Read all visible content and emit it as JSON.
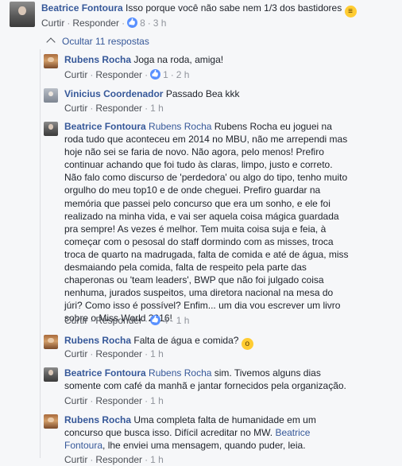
{
  "comments": [
    {
      "author": "Beatrice Fontoura",
      "tag": "",
      "text": "Isso porque você não sabe nem 1/3 dos bastidores",
      "emoji": "😬",
      "reply": "Curtir",
      "respond": "Responder",
      "likes": "8",
      "time": "3 h"
    },
    {
      "author": "Rubens Rocha",
      "tag": "",
      "text": "Joga na roda, amiga!",
      "reply": "Curtir",
      "respond": "Responder",
      "likes": "1",
      "time": "2 h"
    },
    {
      "author": "Vinicius Coordenador",
      "tag": "",
      "text": "Passado Bea kkk",
      "reply": "Curtir",
      "respond": "Responder",
      "time": "1 h"
    },
    {
      "author": "Beatrice Fontoura",
      "tag": "Rubens Rocha",
      "text": "Rubens Rocha eu joguei na roda tudo que aconteceu em 2014 no MBU, não me arrependi mas hoje não sei se faria de novo. Não agora, pelo menos! Prefiro continuar achando que foi tudo às claras, limpo, justo e correto. Não falo como discurso de 'perdedora' ou algo do tipo, tenho muito orgulho do meu top10 e de onde cheguei. Prefiro guardar na memória que passei pelo concurso que era um sonho, e ele foi realizado na minha vida, e vai ser aquela coisa mágica guardada pra sempre! As vezes é melhor. Tem muita coisa suja e feia, à começar com o pesosal do staff dormindo com as misses, troca troca de quarto na madrugada, falta de comida e até de água, miss desmaiando pela comida, falta de respeito pela parte das chaperonas ou 'team leaders', BWP que não foi julgado coisa nenhuma, jurados suspeitos, uma diretora nacional na mesa do júri? Como isso é possível? Enfim... um dia vou escrever um livro sobre o Miss World 2016!",
      "reply": "Curtir",
      "respond": "Responder",
      "likes": "4",
      "time": "1 h"
    },
    {
      "author": "Rubens Rocha",
      "tag": "",
      "text": "Falta de água e comida?",
      "emoji": "😮",
      "reply": "Curtir",
      "respond": "Responder",
      "time": "1 h"
    },
    {
      "author": "Beatrice Fontoura",
      "tag": "Rubens Rocha",
      "text": "sim. Tivemos alguns dias somente com café da manhã e jantar fornecidos pela organização.",
      "reply": "Curtir",
      "respond": "Responder",
      "time": "1 h"
    },
    {
      "author": "Rubens Rocha",
      "tag": "",
      "text_before": "Uma completa falta de humanidade em um concurso que busca isso. Difícil acreditar no MW.",
      "mention": "Beatrice Fontoura",
      "text_after": ", lhe enviei uma mensagem, quando puder, leia.",
      "reply": "Curtir",
      "respond": "Responder",
      "time": "1 h"
    }
  ],
  "toggle_label": "Ocultar 11 respostas"
}
